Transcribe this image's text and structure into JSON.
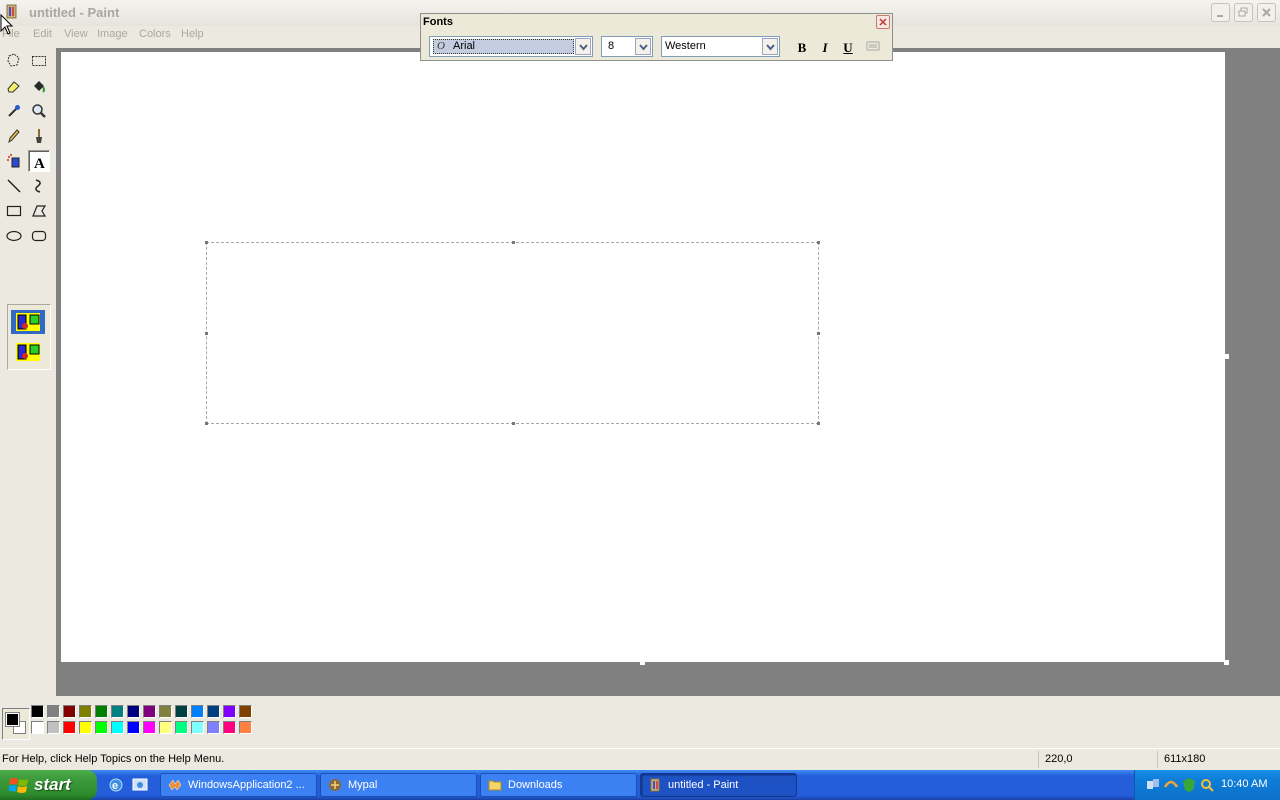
{
  "window": {
    "title": "untitled - Paint",
    "app_icon": "paint-icon"
  },
  "menu": [
    "File",
    "Edit",
    "View",
    "Image",
    "Colors",
    "Help"
  ],
  "tools": [
    {
      "name": "free-form-select-icon"
    },
    {
      "name": "select-icon"
    },
    {
      "name": "eraser-icon"
    },
    {
      "name": "fill-icon"
    },
    {
      "name": "pick-color-icon"
    },
    {
      "name": "magnifier-icon"
    },
    {
      "name": "pencil-icon"
    },
    {
      "name": "brush-icon"
    },
    {
      "name": "airbrush-icon"
    },
    {
      "name": "text-icon",
      "active": true
    },
    {
      "name": "line-icon"
    },
    {
      "name": "curve-icon"
    },
    {
      "name": "rectangle-icon"
    },
    {
      "name": "polygon-icon"
    },
    {
      "name": "ellipse-icon"
    },
    {
      "name": "rounded-rectangle-icon"
    }
  ],
  "fonts_toolbar": {
    "title": "Fonts",
    "font": "Arial",
    "size": "8",
    "script": "Western",
    "bold": "B",
    "italic": "I",
    "underline": "U"
  },
  "palette": {
    "foreground": "#000000",
    "background": "#ffffff",
    "top_row": [
      "#000000",
      "#808080",
      "#800000",
      "#808000",
      "#008000",
      "#008080",
      "#000080",
      "#800080",
      "#808040",
      "#004040",
      "#0080ff",
      "#004080",
      "#8000ff",
      "#804000"
    ],
    "bottom_row": [
      "#ffffff",
      "#c0c0c0",
      "#ff0000",
      "#ffff00",
      "#00ff00",
      "#00ffff",
      "#0000ff",
      "#ff00ff",
      "#ffff80",
      "#00ff80",
      "#80ffff",
      "#8080ff",
      "#ff0080",
      "#ff8040"
    ]
  },
  "status": {
    "help": "For Help, click Help Topics on the Help Menu.",
    "coords": "220,0",
    "size": "611x180"
  },
  "taskbar": {
    "start_label": "start",
    "tasks": [
      {
        "label": "WindowsApplication2 ...",
        "icon": "vb-icon"
      },
      {
        "label": "Mypal",
        "icon": "mypal-icon"
      },
      {
        "label": "Downloads",
        "icon": "folder-icon"
      },
      {
        "label": "untitled - Paint",
        "icon": "paint-icon",
        "active": true
      }
    ],
    "clock": "10:40 AM"
  }
}
